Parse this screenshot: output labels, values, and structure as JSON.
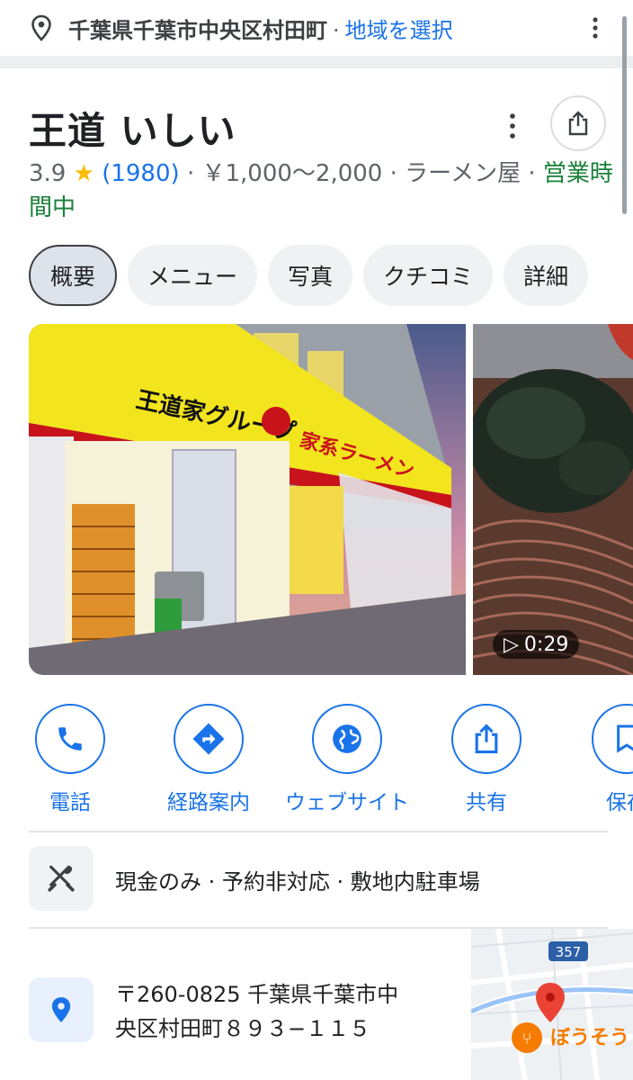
{
  "topbar": {
    "location": "千葉県千葉市中央区村田町",
    "separator": "·",
    "region_link": "地域を選択"
  },
  "place": {
    "name": "王道 いしい",
    "rating": "3.9",
    "review_count": "(1980)",
    "price": "￥1,000〜2,000",
    "category": "ラーメン屋",
    "status": "営業時間中"
  },
  "tabs": [
    "概要",
    "メニュー",
    "写真",
    "クチコミ",
    "詳細"
  ],
  "photos": {
    "sign_main": "王道家グループ",
    "sign_sub": "家系ラーメン",
    "video_duration": "0:29"
  },
  "actions": [
    {
      "label": "電話",
      "icon": "phone-icon"
    },
    {
      "label": "経路案内",
      "icon": "directions-icon"
    },
    {
      "label": "ウェブサイト",
      "icon": "globe-icon"
    },
    {
      "label": "共有",
      "icon": "share-icon"
    },
    {
      "label": "保存",
      "icon": "bookmark-icon"
    }
  ],
  "info": {
    "amenities": "現金のみ · 予約非対応 · 敷地内駐車場"
  },
  "address": {
    "line1": "〒260-0825 千葉県千葉市中",
    "line2": "央区村田町８９３−１１５"
  },
  "minimap": {
    "route_badge": "357",
    "place_label": "ぼうそう"
  },
  "colors": {
    "accent": "#1a73e8",
    "open": "#188038",
    "star": "#fbbc04",
    "pin_red": "#ea4335",
    "food_orange": "#f57c00"
  }
}
